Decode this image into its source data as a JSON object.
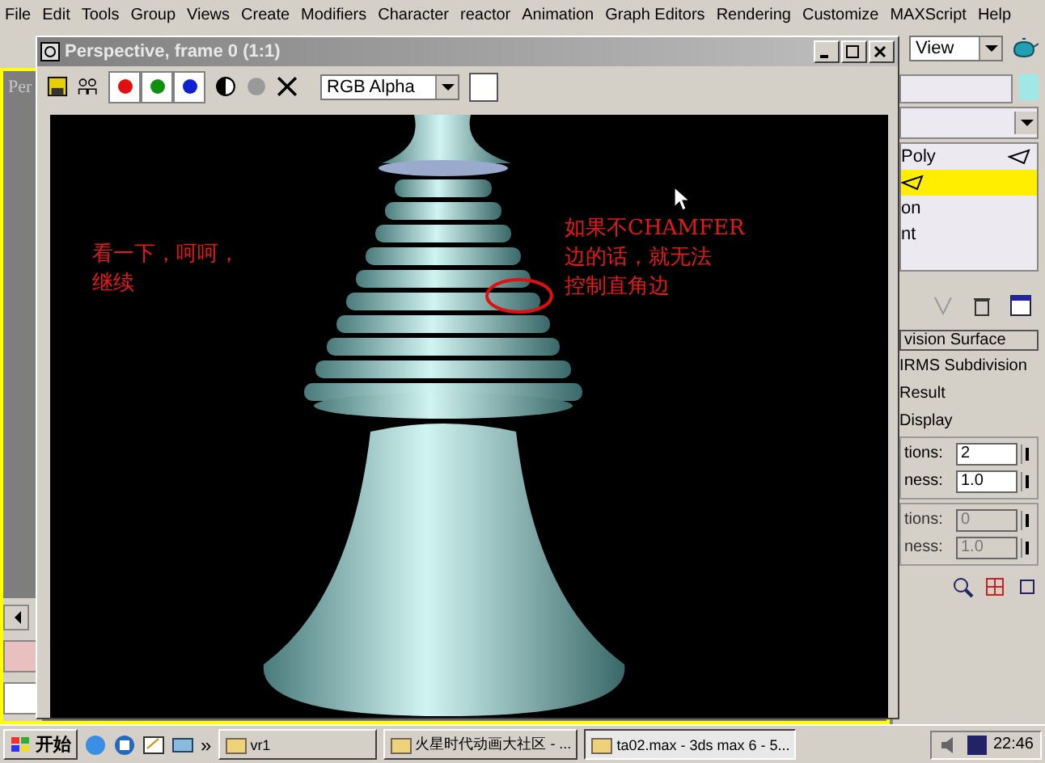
{
  "menu": [
    "File",
    "Edit",
    "Tools",
    "Group",
    "Views",
    "Create",
    "Modifiers",
    "Character",
    "reactor",
    "Animation",
    "Graph Editors",
    "Rendering",
    "Customize",
    "MAXScript",
    "Help"
  ],
  "toolbar": {
    "view_dropdown": "View"
  },
  "viewport": {
    "label": "Per"
  },
  "render_window": {
    "title": "Perspective, frame 0 (1:1)",
    "channels": [
      {
        "color": "#e01010",
        "on": true
      },
      {
        "color": "#109010",
        "on": true
      },
      {
        "color": "#1020d0",
        "on": true
      }
    ],
    "channel_dropdown": "RGB Alpha",
    "annotations": [
      {
        "lines": [
          "看一下，呵呵，",
          "继续"
        ]
      },
      {
        "lines": [
          "如果不CHAMFER",
          "边的话，就无法",
          "控制直角边"
        ]
      }
    ]
  },
  "command_panel": {
    "modifier_list": [
      {
        "kind": "modifier",
        "text": "Poly",
        "selected": false
      },
      {
        "kind": "modifier",
        "selected": true
      },
      {
        "kind": "sub",
        "text": "on",
        "selected": false
      },
      {
        "kind": "sub",
        "text": "nt",
        "selected": false
      }
    ],
    "rollout": {
      "title": "vision Surface",
      "options": [
        "IRMS Subdivision",
        "Result",
        "Display"
      ],
      "spinner_groups": [
        [
          {
            "label": "tions:",
            "value": "2",
            "disabled": false
          },
          {
            "label": "ness:",
            "value": "1.0",
            "disabled": false
          }
        ],
        [
          {
            "label": "tions:",
            "value": "0",
            "disabled": true
          },
          {
            "label": "ness:",
            "value": "1.0",
            "disabled": true
          }
        ]
      ]
    }
  },
  "taskbar": {
    "start": "开始",
    "more": "»",
    "tasks": [
      {
        "text": "vr1",
        "selected": false
      },
      {
        "text": "火星时代动画大社区 - ...",
        "selected": false
      },
      {
        "text": "ta02.max - 3ds max 6 - 5...",
        "selected": true
      }
    ],
    "clock": "22:46"
  }
}
